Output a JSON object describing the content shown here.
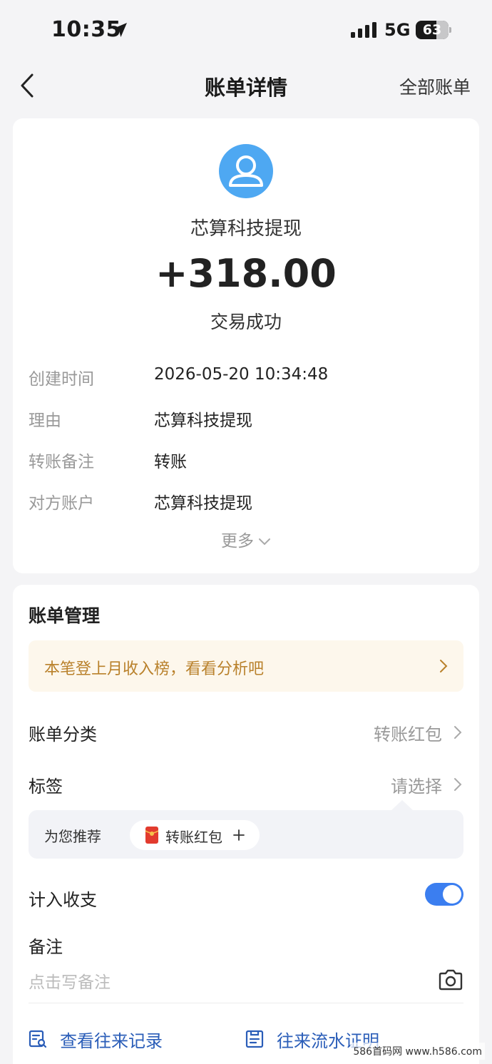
{
  "status_bar": {
    "time": "10:35",
    "network": "5G",
    "battery": "63",
    "battery_level": 0.63
  },
  "nav": {
    "title": "账单详情",
    "right_action": "全部账单"
  },
  "transaction": {
    "payee": "芯算科技提现",
    "amount": "+318.00",
    "status": "交易成功",
    "details": [
      {
        "label": "创建时间",
        "value": "2026-05-20 10:34:48"
      },
      {
        "label": "理由",
        "value": "芯算科技提现"
      },
      {
        "label": "转账备注",
        "value": "转账"
      },
      {
        "label": "对方账户",
        "value": "芯算科技提现"
      }
    ],
    "more_label": "更多"
  },
  "manage": {
    "title": "账单管理",
    "promo_text": "本笔登上月收入榜，看看分析吧",
    "category": {
      "label": "账单分类",
      "value": "转账红包"
    },
    "tag": {
      "label": "标签",
      "value": "请选择"
    },
    "recommend": {
      "label": "为您推荐",
      "chip_label": "转账红包"
    },
    "include_stats": {
      "label": "计入收支",
      "enabled": true
    },
    "note": {
      "label": "备注",
      "placeholder": "点击写备注"
    },
    "links": [
      {
        "label": "查看往来记录"
      },
      {
        "label": "往来流水证明"
      }
    ]
  },
  "watermark": "586首码网 www.h586.com",
  "colors": {
    "accent": "#3b7ef0",
    "promo_text": "#b9812b",
    "link": "#2a5db8",
    "avatar": "#4ea8f2"
  }
}
